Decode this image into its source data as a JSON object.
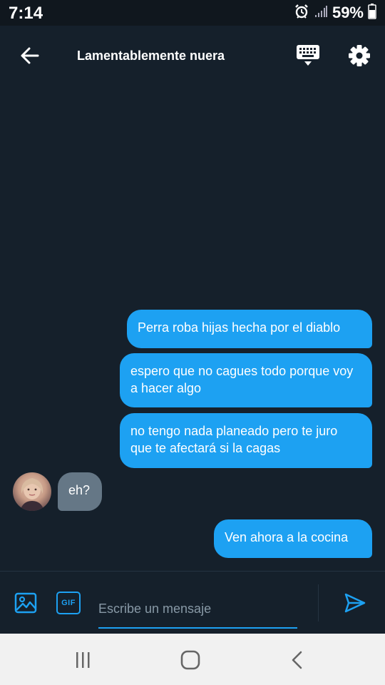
{
  "status_bar": {
    "time": "7:14",
    "battery_percent": "59%",
    "icons": [
      "alarm-icon",
      "signal-icon",
      "battery-icon"
    ]
  },
  "header": {
    "title": "Lamentablemente nuera",
    "icons": [
      "back-arrow-icon",
      "keyboard-icon",
      "gear-icon"
    ]
  },
  "messages": [
    {
      "direction": "outgoing",
      "text": "Perra roba hijas hecha por el diablo"
    },
    {
      "direction": "outgoing",
      "text": "espero que no cagues todo porque voy a hacer algo"
    },
    {
      "direction": "outgoing",
      "text": "no tengo nada planeado pero te juro que te afectará si la cagas"
    },
    {
      "direction": "incoming",
      "text": "eh?"
    },
    {
      "direction": "outgoing",
      "text": "Ven ahora a la cocina"
    }
  ],
  "composer": {
    "placeholder": "Escribe un mensaje",
    "value": "",
    "gif_label": "GIF",
    "icons": [
      "image-icon",
      "send-icon"
    ]
  },
  "navbar": {
    "icons": [
      "recent-apps-icon",
      "home-icon",
      "nav-back-icon"
    ]
  },
  "colors": {
    "background": "#15202b",
    "accent": "#1da1f2",
    "incoming_bubble": "#657786",
    "navbar": "#f1f1f1"
  }
}
